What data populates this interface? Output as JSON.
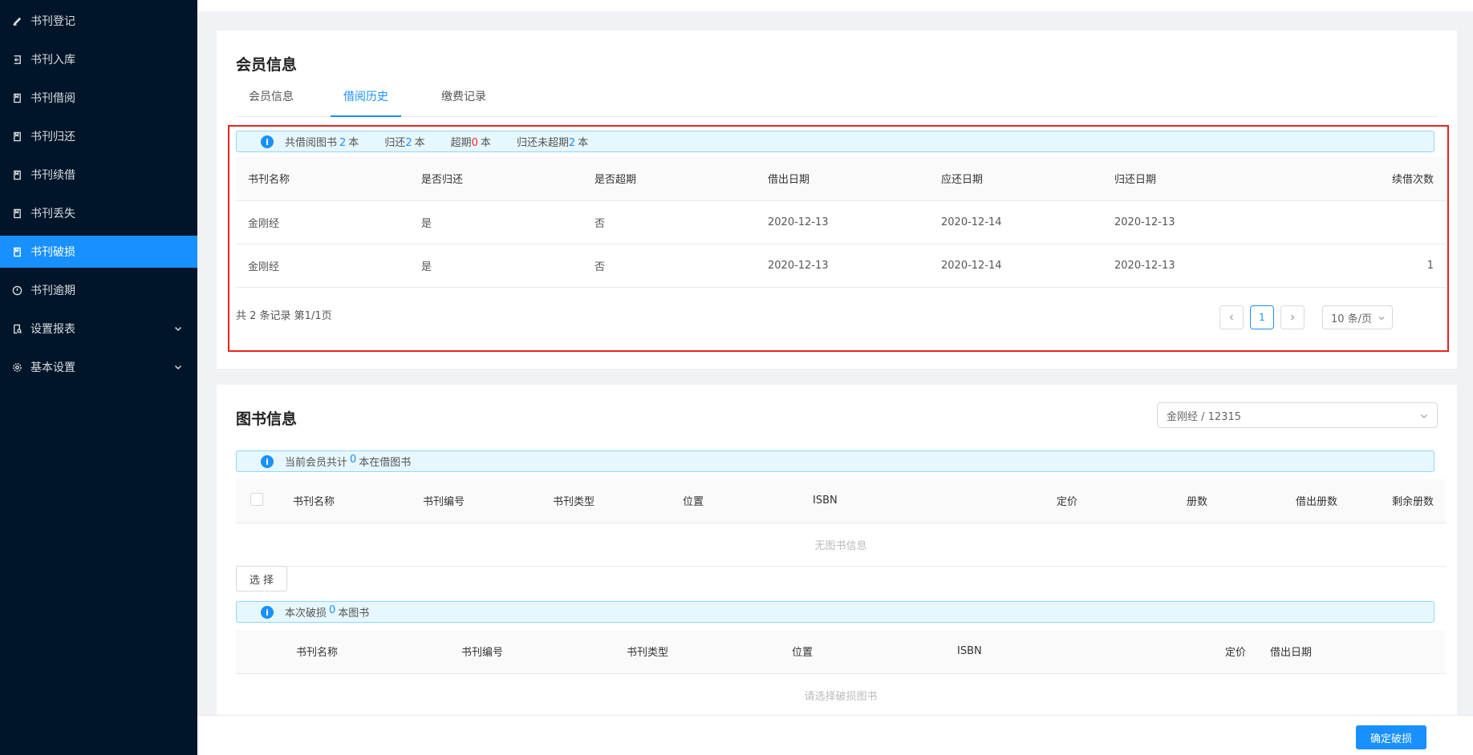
{
  "sidebar": {
    "items": [
      {
        "label": "书刊登记",
        "icon": "pen-icon"
      },
      {
        "label": "书刊入库",
        "icon": "login-icon"
      },
      {
        "label": "书刊借阅",
        "icon": "book-icon"
      },
      {
        "label": "书刊归还",
        "icon": "book-icon"
      },
      {
        "label": "书刊续借",
        "icon": "book-icon"
      },
      {
        "label": "书刊丢失",
        "icon": "book-icon"
      },
      {
        "label": "书刊破损",
        "icon": "book-icon",
        "active": true
      },
      {
        "label": "书刊逾期",
        "icon": "clock-icon"
      },
      {
        "label": "设置报表",
        "icon": "report-icon",
        "has_children": true
      },
      {
        "label": "基本设置",
        "icon": "gear-icon",
        "has_children": true
      }
    ]
  },
  "member": {
    "title": "会员信息",
    "tabs": [
      "会员信息",
      "借阅历史",
      "缴费记录"
    ],
    "active_tab": "借阅历史",
    "summary": {
      "t1": "共借阅图书",
      "v1": "2",
      "u1": "本",
      "t2": "归还",
      "v2": "2",
      "u2": "本",
      "t3": "超期",
      "v3": "0",
      "u3": "本",
      "t4": "归还未超期",
      "v4": "2",
      "u4": "本"
    },
    "columns": [
      "书刊名称",
      "是否归还",
      "是否超期",
      "借出日期",
      "应还日期",
      "归还日期",
      "续借次数"
    ],
    "rows": [
      [
        "金刚经",
        "是",
        "否",
        "2020-12-13",
        "2020-12-14",
        "2020-12-13",
        ""
      ],
      [
        "金刚经",
        "是",
        "否",
        "2020-12-13",
        "2020-12-14",
        "2020-12-13",
        "1"
      ]
    ],
    "pagination": {
      "info": "共 2 条记录 第1/1页",
      "current_page": "1",
      "page_size": "10 条/页"
    }
  },
  "books": {
    "title": "图书信息",
    "select_value": "金刚经 / 12315",
    "alert": {
      "prefix": "当前会员共计",
      "count": "0",
      "suffix": "本在借图书"
    },
    "columns": [
      "书刊名称",
      "书刊编号",
      "书刊类型",
      "位置",
      "ISBN",
      "定价",
      "册数",
      "借出册数",
      "剩余册数"
    ],
    "empty_text": "无图书信息",
    "select_button": "选 择",
    "damage_alert": {
      "prefix": "本次破损",
      "count": "0",
      "suffix": "本图书"
    },
    "damage_columns": [
      "书刊名称",
      "书刊编号",
      "书刊类型",
      "位置",
      "ISBN",
      "定价",
      "借出日期"
    ],
    "damage_empty_text": "请选择破损图书"
  },
  "footer": {
    "confirm_label": "确定破损"
  }
}
